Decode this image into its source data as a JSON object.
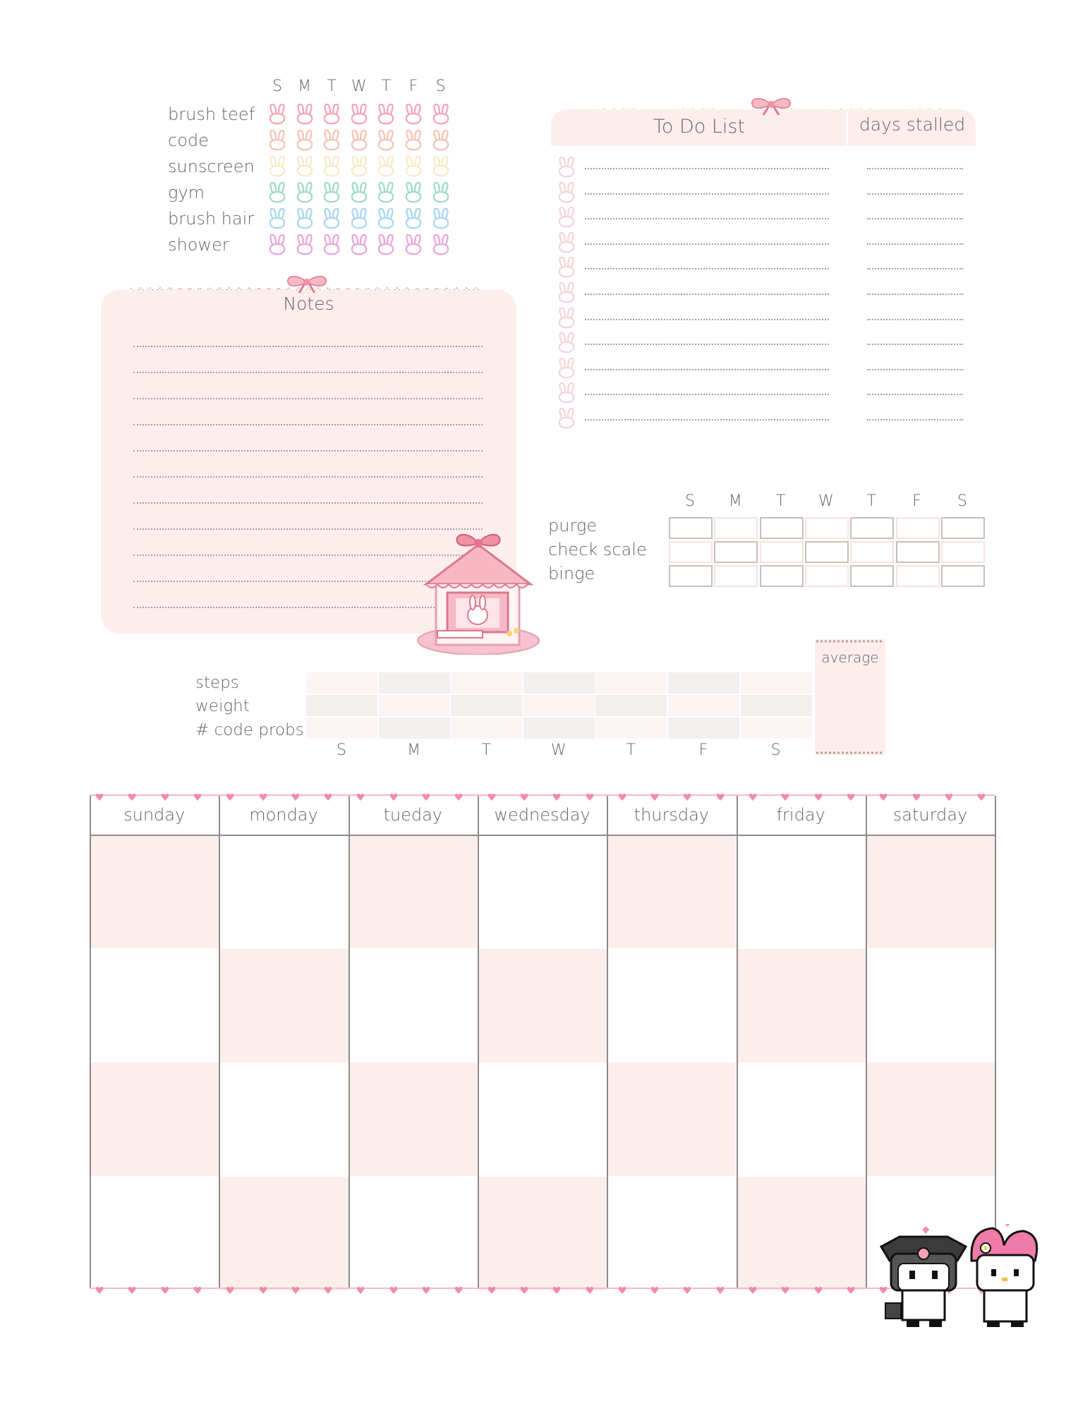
{
  "habits": {
    "day_letters": [
      "S",
      "M",
      "T",
      "W",
      "T",
      "F",
      "S"
    ],
    "rows": [
      {
        "label": "brush teef",
        "color": "#f4a3b6"
      },
      {
        "label": "code",
        "color": "#f6c1b3"
      },
      {
        "label": "sunscreen",
        "color": "#f8eac4"
      },
      {
        "label": "gym",
        "color": "#9edbc6"
      },
      {
        "label": "brush hair",
        "color": "#a7d6ef"
      },
      {
        "label": "shower",
        "color": "#e9a4dc"
      }
    ]
  },
  "notes": {
    "title": "Notes",
    "line_count": 11
  },
  "todo": {
    "title": "To Do List",
    "stalled_title": "days stalled",
    "line_count": 11
  },
  "body_tracker": {
    "day_letters": [
      "S",
      "M",
      "T",
      "W",
      "T",
      "F",
      "S"
    ],
    "rows": [
      {
        "label": "purge",
        "pattern": [
          "gray",
          "pink",
          "gray",
          "pink",
          "gray",
          "pink",
          "gray"
        ]
      },
      {
        "label": "check scale",
        "pattern": [
          "pink",
          "gray",
          "pink",
          "gray",
          "pink",
          "gray",
          "pink"
        ]
      },
      {
        "label": "binge",
        "pattern": [
          "gray",
          "pink",
          "gray",
          "pink",
          "gray",
          "pink",
          "gray"
        ]
      }
    ]
  },
  "stats": {
    "rows": [
      "steps",
      "weight",
      "# code probs"
    ],
    "day_letters": [
      "S",
      "M",
      "T",
      "W",
      "T",
      "F",
      "S"
    ],
    "average_label": "average"
  },
  "calendar": {
    "days": [
      "sunday",
      "monday",
      "tueday",
      "wednesday",
      "thursday",
      "friday",
      "saturday"
    ]
  },
  "colors": {
    "pink_fill": "#fdeeee",
    "text": "#6b6262",
    "heart": "#f08ca4"
  }
}
